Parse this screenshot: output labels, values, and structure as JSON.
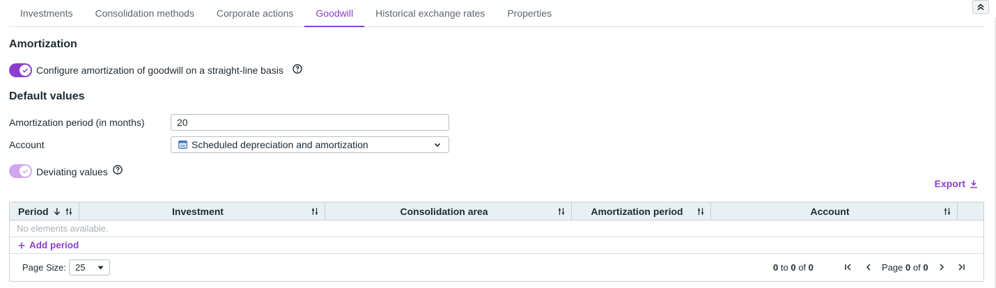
{
  "tabs": [
    {
      "label": "Investments",
      "active": false
    },
    {
      "label": "Consolidation methods",
      "active": false
    },
    {
      "label": "Corporate actions",
      "active": false
    },
    {
      "label": "Goodwill",
      "active": true
    },
    {
      "label": "Historical exchange rates",
      "active": false
    },
    {
      "label": "Properties",
      "active": false
    }
  ],
  "amortization": {
    "title": "Amortization",
    "toggle_label": "Configure amortization of goodwill on a straight-line basis",
    "toggle_on": true
  },
  "defaults": {
    "title": "Default values",
    "period_label": "Amortization period (in months)",
    "period_value": "20",
    "account_label": "Account",
    "account_value": "Scheduled depreciation and amortization"
  },
  "deviating": {
    "toggle_label": "Deviating values",
    "toggle_on": true
  },
  "export_label": "Export",
  "grid": {
    "columns": [
      "Period",
      "Investment",
      "Consolidation area",
      "Amortization period",
      "Account"
    ],
    "empty_text": "No elements available.",
    "add_label": "Add period"
  },
  "pager": {
    "page_size_label": "Page Size:",
    "page_size": "25",
    "range_from": "0",
    "range_to": "0",
    "range_total": "0",
    "to_word": "to",
    "of_word": "of",
    "page_word": "Page",
    "page_current": "0",
    "page_total": "0"
  },
  "colors": {
    "accent": "#8a3ecf",
    "header_bg": "#e8f0f4",
    "text": "#1d2a33"
  },
  "icons": [
    "collapse-up-icon",
    "check-icon",
    "help-icon",
    "chevron-down-icon",
    "account-icon",
    "download-icon",
    "sort-down-icon",
    "filter-icon",
    "plus-icon",
    "first-page-icon",
    "prev-page-icon",
    "next-page-icon",
    "last-page-icon"
  ]
}
